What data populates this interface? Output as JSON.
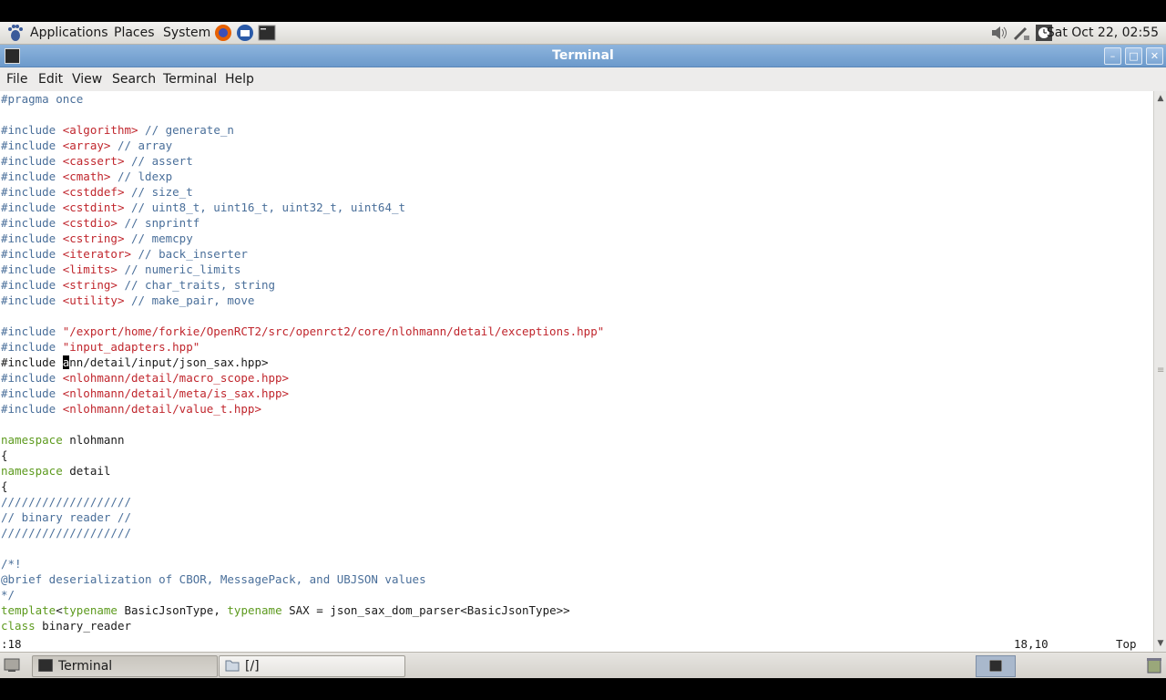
{
  "top_panel": {
    "menus": [
      "Applications",
      "Places",
      "System"
    ],
    "clock": "Sat Oct 22, 02:55"
  },
  "window": {
    "title": "Terminal",
    "menubar": [
      "File",
      "Edit",
      "View",
      "Search",
      "Terminal",
      "Help"
    ]
  },
  "editor": {
    "lines": [
      [
        {
          "t": "#pragma once",
          "c": "pp"
        }
      ],
      [],
      [
        {
          "t": "#include ",
          "c": "pp"
        },
        {
          "t": "<algorithm>",
          "c": "str"
        },
        {
          "t": " // generate_n",
          "c": "cm"
        }
      ],
      [
        {
          "t": "#include ",
          "c": "pp"
        },
        {
          "t": "<array>",
          "c": "str"
        },
        {
          "t": " // array",
          "c": "cm"
        }
      ],
      [
        {
          "t": "#include ",
          "c": "pp"
        },
        {
          "t": "<cassert>",
          "c": "str"
        },
        {
          "t": " // assert",
          "c": "cm"
        }
      ],
      [
        {
          "t": "#include ",
          "c": "pp"
        },
        {
          "t": "<cmath>",
          "c": "str"
        },
        {
          "t": " // ldexp",
          "c": "cm"
        }
      ],
      [
        {
          "t": "#include ",
          "c": "pp"
        },
        {
          "t": "<cstddef>",
          "c": "str"
        },
        {
          "t": " // size_t",
          "c": "cm"
        }
      ],
      [
        {
          "t": "#include ",
          "c": "pp"
        },
        {
          "t": "<cstdint>",
          "c": "str"
        },
        {
          "t": " // uint8_t, uint16_t, uint32_t, uint64_t",
          "c": "cm"
        }
      ],
      [
        {
          "t": "#include ",
          "c": "pp"
        },
        {
          "t": "<cstdio>",
          "c": "str"
        },
        {
          "t": " // snprintf",
          "c": "cm"
        }
      ],
      [
        {
          "t": "#include ",
          "c": "pp"
        },
        {
          "t": "<cstring>",
          "c": "str"
        },
        {
          "t": " // memcpy",
          "c": "cm"
        }
      ],
      [
        {
          "t": "#include ",
          "c": "pp"
        },
        {
          "t": "<iterator>",
          "c": "str"
        },
        {
          "t": " // back_inserter",
          "c": "cm"
        }
      ],
      [
        {
          "t": "#include ",
          "c": "pp"
        },
        {
          "t": "<limits>",
          "c": "str"
        },
        {
          "t": " // numeric_limits",
          "c": "cm"
        }
      ],
      [
        {
          "t": "#include ",
          "c": "pp"
        },
        {
          "t": "<string>",
          "c": "str"
        },
        {
          "t": " // char_traits, string",
          "c": "cm"
        }
      ],
      [
        {
          "t": "#include ",
          "c": "pp"
        },
        {
          "t": "<utility>",
          "c": "str"
        },
        {
          "t": " // make_pair, move",
          "c": "cm"
        }
      ],
      [],
      [
        {
          "t": "#include ",
          "c": "pp"
        },
        {
          "t": "\"/export/home/forkie/OpenRCT2/src/openrct2/core/nlohmann/detail/exceptions.hpp\"",
          "c": "str"
        }
      ],
      [
        {
          "t": "#include ",
          "c": "pp"
        },
        {
          "t": "\"input_adapters.hpp\"",
          "c": "str"
        }
      ],
      [
        {
          "t": "#include ",
          "c": ""
        },
        {
          "t": "a",
          "c": "cur"
        },
        {
          "t": "nn/detail/input/json_sax.hpp>",
          "c": ""
        }
      ],
      [
        {
          "t": "#include ",
          "c": "pp"
        },
        {
          "t": "<nlohmann/detail/macro_scope.hpp>",
          "c": "str"
        }
      ],
      [
        {
          "t": "#include ",
          "c": "pp"
        },
        {
          "t": "<nlohmann/detail/meta/is_sax.hpp>",
          "c": "str"
        }
      ],
      [
        {
          "t": "#include ",
          "c": "pp"
        },
        {
          "t": "<nlohmann/detail/value_t.hpp>",
          "c": "str"
        }
      ],
      [],
      [
        {
          "t": "namespace",
          "c": "kw"
        },
        {
          "t": " nlohmann",
          "c": ""
        }
      ],
      [
        {
          "t": "{",
          "c": ""
        }
      ],
      [
        {
          "t": "namespace",
          "c": "kw"
        },
        {
          "t": " detail",
          "c": ""
        }
      ],
      [
        {
          "t": "{",
          "c": ""
        }
      ],
      [
        {
          "t": "///////////////////",
          "c": "cm"
        }
      ],
      [
        {
          "t": "// binary reader //",
          "c": "cm"
        }
      ],
      [
        {
          "t": "///////////////////",
          "c": "cm"
        }
      ],
      [],
      [
        {
          "t": "/*!",
          "c": "cm"
        }
      ],
      [
        {
          "t": "@brief deserialization of CBOR, MessagePack, and UBJSON values",
          "c": "cm"
        }
      ],
      [
        {
          "t": "*/",
          "c": "cm"
        }
      ],
      [
        {
          "t": "template",
          "c": "kw"
        },
        {
          "t": "<",
          "c": ""
        },
        {
          "t": "typename",
          "c": "kw"
        },
        {
          "t": " BasicJsonType, ",
          "c": ""
        },
        {
          "t": "typename",
          "c": "kw"
        },
        {
          "t": " SAX = json_sax_dom_parser<BasicJsonType>>",
          "c": ""
        }
      ],
      [
        {
          "t": "class",
          "c": "kw"
        },
        {
          "t": " binary_reader",
          "c": ""
        }
      ]
    ],
    "command_line": ":18",
    "position": "18,10",
    "scroll_pos": "Top"
  },
  "taskbar": {
    "items": [
      "Terminal",
      "[/]"
    ]
  }
}
